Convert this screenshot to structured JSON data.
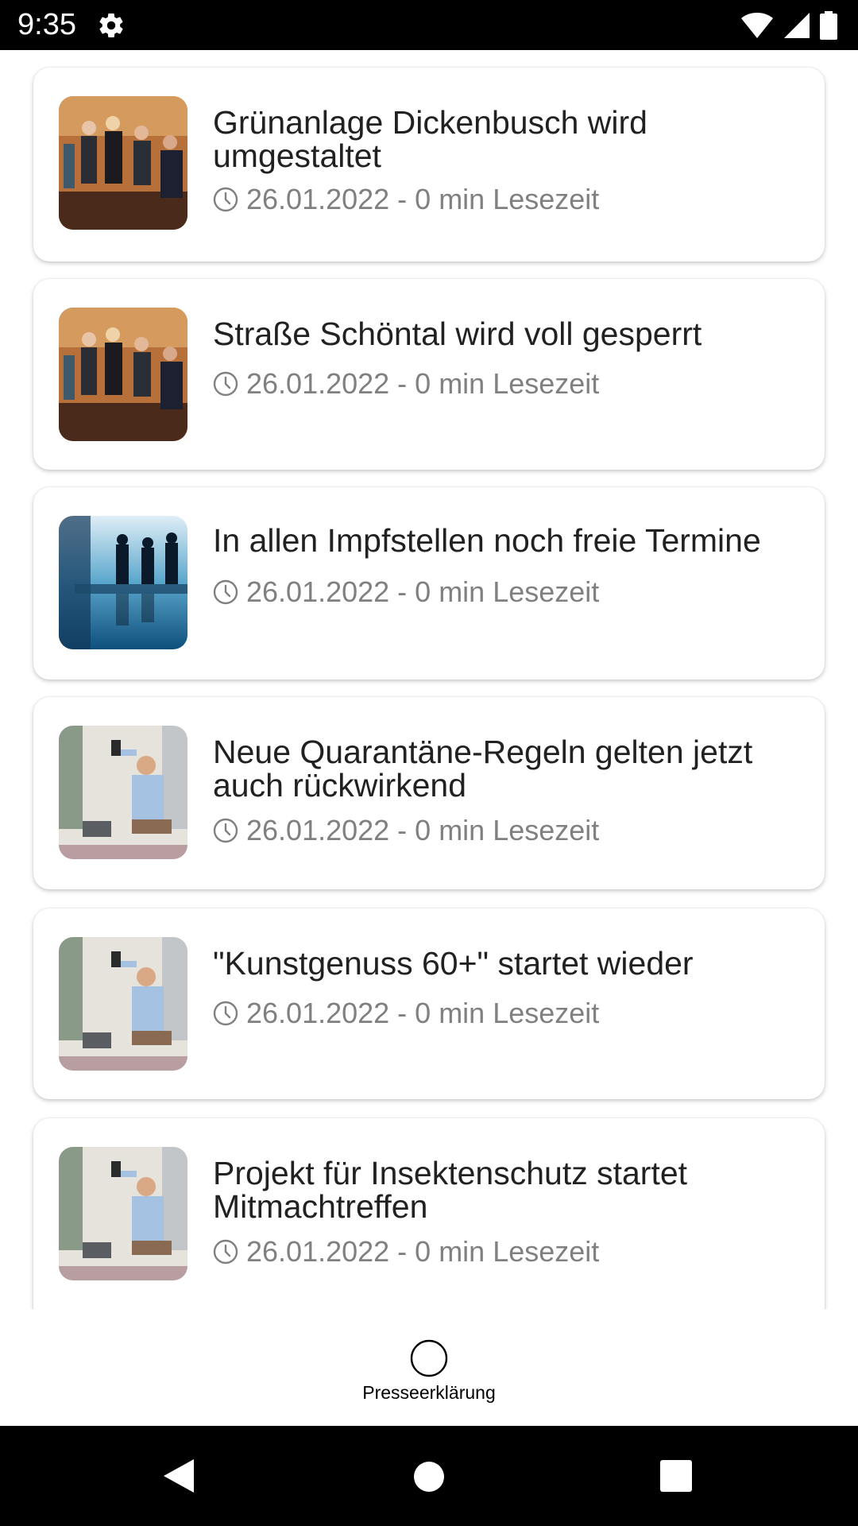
{
  "status_bar": {
    "time": "9:35",
    "icons": [
      "gear-icon",
      "wifi-icon",
      "signal-icon",
      "battery-icon"
    ]
  },
  "articles": [
    {
      "title": "Grünanlage Dickenbusch wird umgestaltet",
      "meta": "26.01.2022 - 0 min Lesezeit",
      "image": "team-meeting-warm-photo"
    },
    {
      "title": "Straße Schöntal wird voll gesperrt",
      "meta": "26.01.2022 - 0 min Lesezeit",
      "image": "team-meeting-warm-photo"
    },
    {
      "title": "In allen Impfstellen noch freie Termine",
      "meta": "26.01.2022 - 0 min Lesezeit",
      "image": "blue-conference-room-photo"
    },
    {
      "title": "Neue Quarantäne-Regeln gelten jetzt auch rückwirkend",
      "meta": "26.01.2022 - 0 min Lesezeit",
      "image": "man-selfie-office-photo"
    },
    {
      "title": "\"Kunstgenuss 60+\" startet wieder",
      "meta": "26.01.2022 - 0 min Lesezeit",
      "image": "man-selfie-office-photo"
    },
    {
      "title": "Projekt für Insektenschutz startet Mitmachtreffen",
      "meta": "26.01.2022 - 0 min Lesezeit",
      "image": "man-selfie-office-photo"
    }
  ],
  "bottom_nav": {
    "label": "Presseerklärung",
    "icon": "circle-icon"
  },
  "system_nav": {
    "icons": [
      "back-icon",
      "home-icon",
      "recents-icon"
    ]
  },
  "colors": {
    "title": "#212121",
    "meta": "#808080",
    "status_bar": "#000000"
  }
}
